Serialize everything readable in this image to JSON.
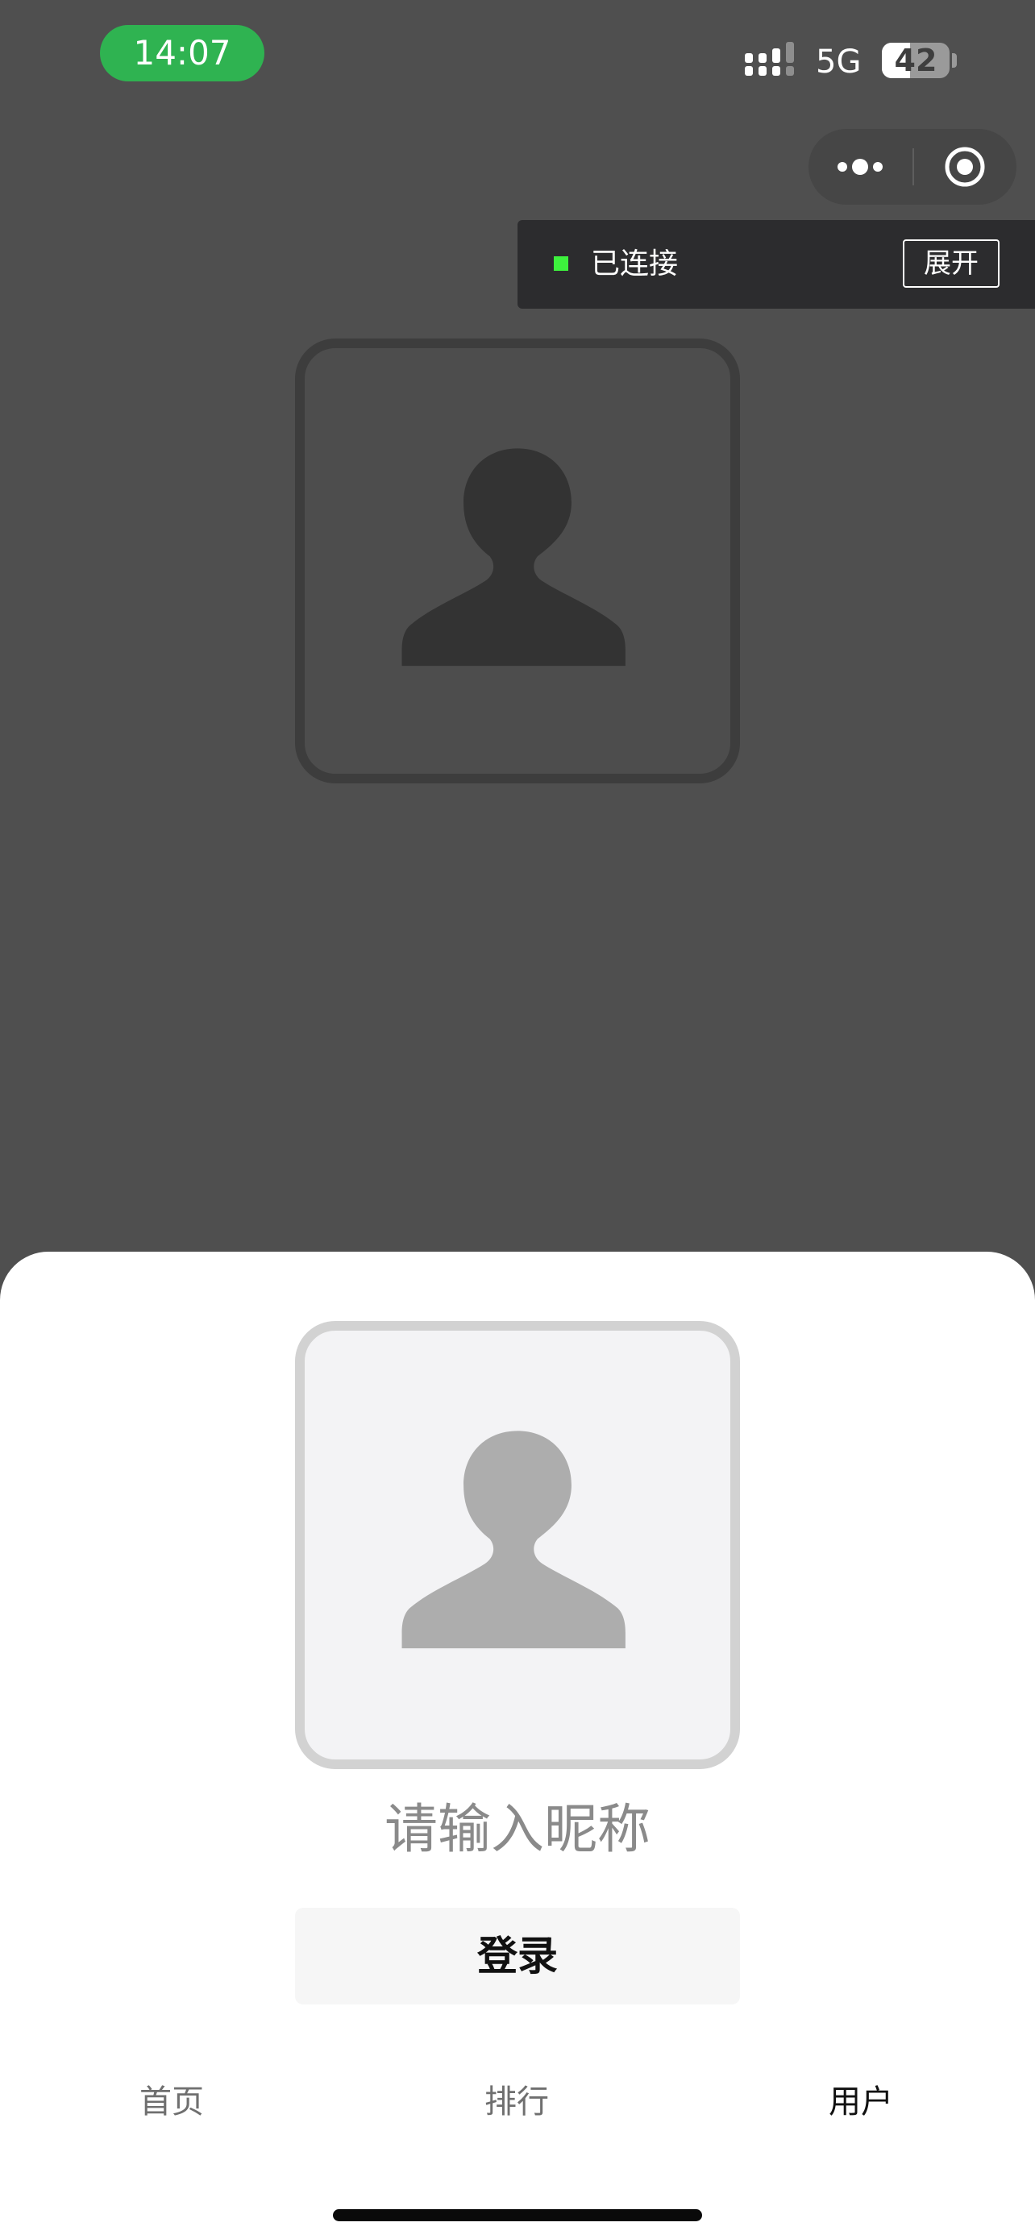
{
  "status_bar": {
    "time": "14:07",
    "network": "5G",
    "battery_level": "42",
    "battery_fraction": 0.42,
    "icons": [
      "signal-icon",
      "battery-icon"
    ]
  },
  "capsule": {
    "icons": [
      "more-icon",
      "close-miniprogram-icon"
    ]
  },
  "connection": {
    "status_text": "已连接",
    "expand_label": "展开",
    "status_color": "#3df23d"
  },
  "login": {
    "nickname_placeholder": "请输入昵称",
    "nickname_value": "",
    "login_label": "登录"
  },
  "tabbar": {
    "items": [
      {
        "label": "首页",
        "active": false
      },
      {
        "label": "排行",
        "active": false
      },
      {
        "label": "用户",
        "active": true
      }
    ]
  },
  "colors": {
    "time_pill": "#2fb351",
    "overlay": "#4f4f4f",
    "sheet": "#ffffff"
  }
}
